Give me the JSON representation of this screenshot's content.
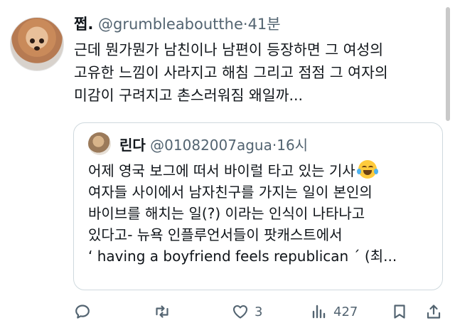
{
  "tweet": {
    "display_name": "쩝.",
    "handle": "@grumbleaboutthe",
    "separator": "·",
    "time": "41분",
    "lines": [
      "근데 뭔가뭔가 남친이나 남편이 등장하면 그 여성의",
      "고유한 느낌이 사라지고 해침 그리고 점점 그 여자의",
      "미감이 구려지고 촌스러워짐 왜일까..."
    ]
  },
  "quote": {
    "display_name": "린다",
    "handle": "@01082007agua",
    "separator": "·",
    "time": "16시",
    "lines": [
      "어제 영국 보그에 떠서 바이럴 타고 있는 기사",
      "여자들 사이에서 남자친구를 가지는 일이 본인의",
      "바이브를 해치는 일(?) 이라는 인식이 나타나고",
      "있다고- 뉴욕 인플루언서들이 팟캐스트에서",
      "‘ having a boyfriend feels republican ´ (최..."
    ],
    "emoji": "face-with-tears-of-joy"
  },
  "actions": {
    "reply_icon": "reply-icon",
    "retweet_icon": "retweet-icon",
    "like_icon": "heart-icon",
    "like_count": "3",
    "views_icon": "views-icon",
    "views_count": "427",
    "bookmark_icon": "bookmark-icon",
    "share_icon": "share-icon"
  },
  "colors": {
    "text": "#0f1419",
    "secondary": "#536471",
    "border": "#cfd9de"
  }
}
